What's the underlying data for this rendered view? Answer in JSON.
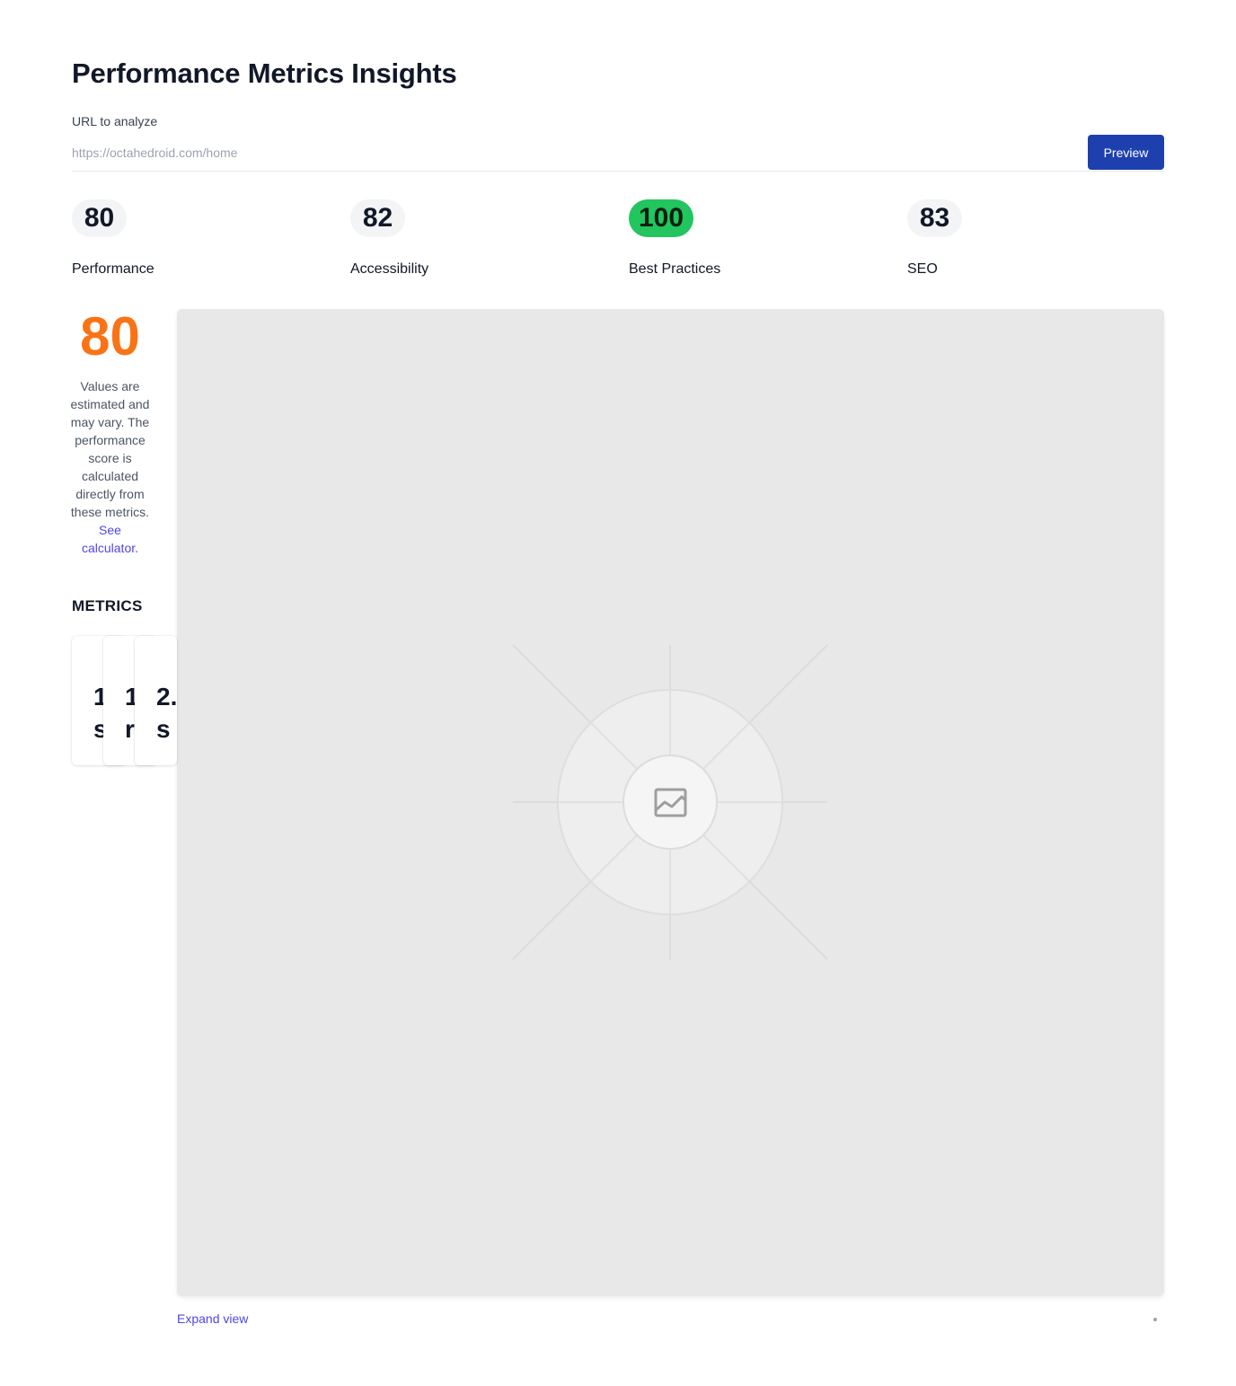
{
  "page": {
    "title": "Performance Metrics Insights"
  },
  "url_form": {
    "label": "URL to analyze",
    "placeholder": "https://octahedroid.com/home",
    "value": "",
    "button_label": "Preview"
  },
  "scores": [
    {
      "label": "Performance",
      "value": "80",
      "status": "average"
    },
    {
      "label": "Accessibility",
      "value": "82",
      "status": "average"
    },
    {
      "label": "Best Practices",
      "value": "100",
      "status": "good"
    },
    {
      "label": "SEO",
      "value": "83",
      "status": "average"
    }
  ],
  "performance_detail": {
    "score": "80",
    "score_color": "#f97316",
    "note": "Values are estimated and may vary. The performance score is calculated directly from these metrics.",
    "link_text": "See calculator."
  },
  "metrics": {
    "heading": "METRICS",
    "cards": [
      {
        "value": "1 s"
      },
      {
        "value": "1 r"
      },
      {
        "value": "2. s"
      }
    ]
  },
  "preview": {
    "icon": "image-placeholder-icon",
    "expand_label": "Expand view"
  },
  "colors": {
    "accent": "#1e40af",
    "good": "#22c55e",
    "average": "#f97316",
    "link": "#4f46e5"
  }
}
